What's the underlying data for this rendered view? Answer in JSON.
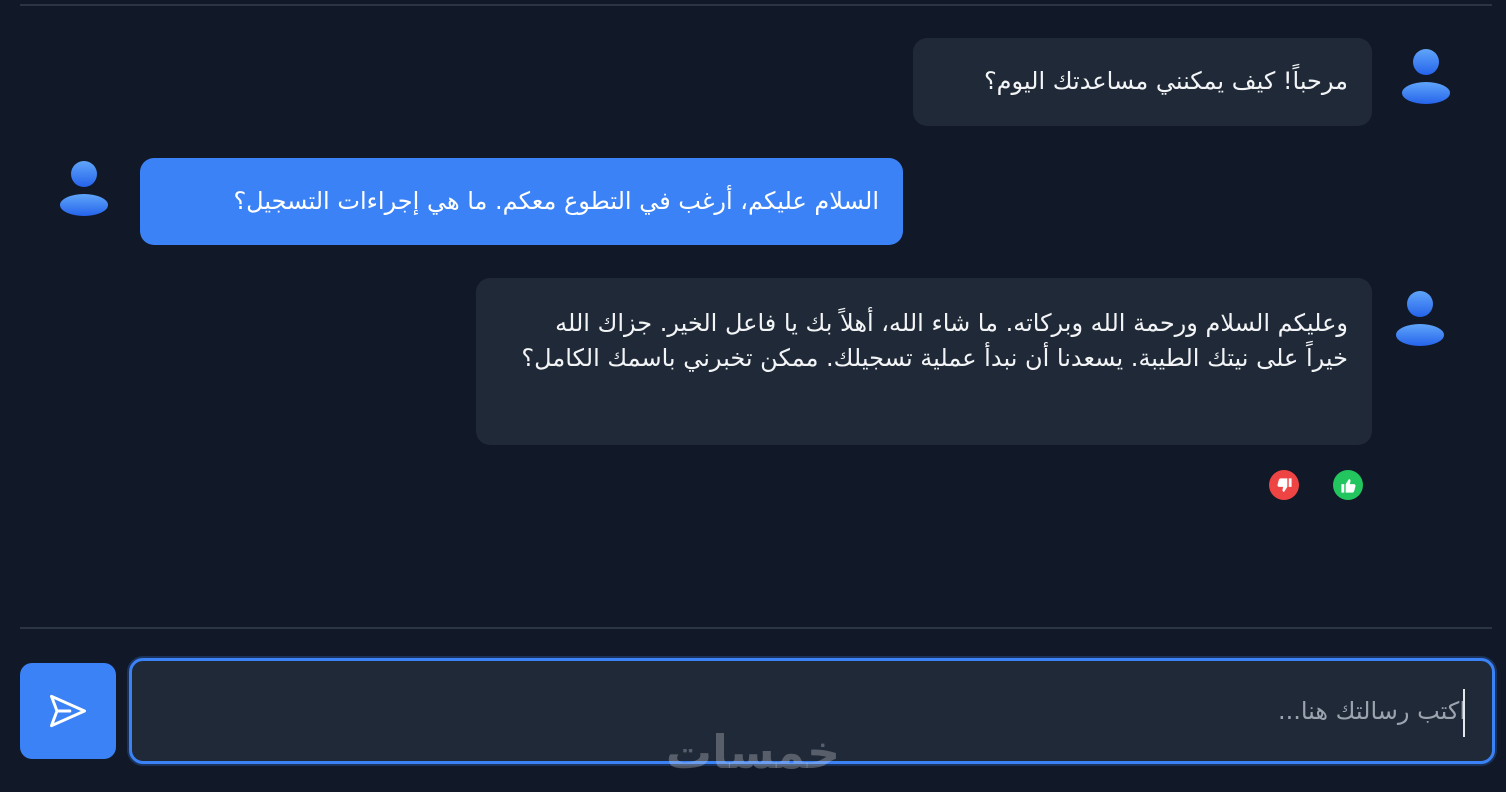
{
  "messages": [
    {
      "role": "bot",
      "text": "مرحباً! كيف يمكنني مساعدتك اليوم؟"
    },
    {
      "role": "user",
      "text": "السلام عليكم، أرغب في التطوع معكم. ما هي إجراءات التسجيل؟"
    },
    {
      "role": "bot",
      "text": "وعليكم السلام ورحمة الله وبركاته. ما شاء الله، أهلاً بك يا فاعل الخير. جزاك الله خيراً على نيتك الطيبة. يسعدنا أن نبدأ عملية تسجيلك. ممكن تخبرني باسمك الكامل؟"
    }
  ],
  "feedback": {
    "like_icon": "thumbs-up-icon",
    "dislike_icon": "thumbs-down-icon"
  },
  "composer": {
    "placeholder": "اكتب رسالتك هنا...",
    "value": "",
    "send_icon": "send-icon"
  },
  "watermark": "خمسات",
  "colors": {
    "background": "#111827",
    "bot_bubble": "#1f2937",
    "user_bubble": "#3b82f6",
    "accent": "#3b82f6",
    "like": "#22c55e",
    "dislike": "#ef4444"
  }
}
